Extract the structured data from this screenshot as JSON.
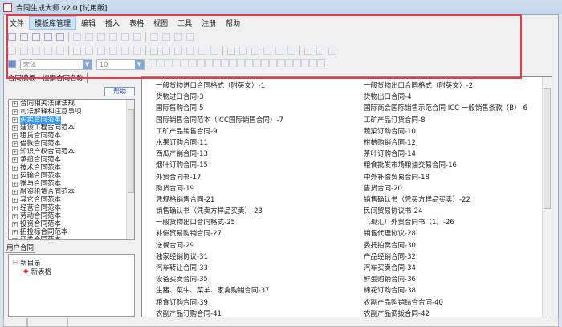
{
  "title": "合同生成大师 v2.0 [试用版]",
  "menu": [
    "文件",
    "模板库管理",
    "编辑",
    "插入",
    "表格",
    "视图",
    "工具",
    "注册",
    "帮助"
  ],
  "font": {
    "name": "宋体",
    "size": "10"
  },
  "tabs": [
    "合同模板",
    "搜索合同名称"
  ],
  "help_label": "帮助",
  "tree": [
    "合同相关法律法规",
    "司法解释和注意事项",
    "买卖合同范本",
    "建设工程合同范本",
    "租赁合同范本",
    "借款合同范本",
    "知识产权合同范本",
    "承揽合同范本",
    "技术合同范本",
    "运输合同范本",
    "赠与合同范本",
    "融资租赁合同范本",
    "其它合同范本",
    "经营合同范本",
    "劳动合同范本",
    "投资合同范本",
    "招投标合同范本",
    "证券合同范本"
  ],
  "tree_selected": 2,
  "user": {
    "header": "用户合同",
    "folder": "新目录",
    "file": "新表格"
  },
  "list_left": [
    "一般货物进口合同格式（附英文）-1",
    "货物进口合同-3",
    "国际售购合同-5",
    "国际销售合同范本（ICC国际销售合同）-7",
    "工矿产品销售合同-9",
    "水果订购合同-11",
    "西瓜产销合同-13",
    "烟叶订购合同-15",
    "外贸合同书-17",
    "购货合同-19",
    "凭规格销售合同-21",
    "销售确认书（凭卖方样品买卖）-23",
    "一般货物出口合同格式-25",
    "补偿贸易购销合同-27",
    "送餐合同-29",
    "独家经销协议-31",
    "汽车转让合同-33",
    "设备买卖合同-35",
    "生猪、菜牛、菜羊、家禽购销合同-37",
    "粮食订购合同-39",
    "农副产品订购合同-41"
  ],
  "list_right": [
    "一般货物出口合同格式（附英文）-2",
    "货物出口合同-4",
    "国际商会国际销售示范合同 ICC 一般销售条款（B）-6",
    "工矿产品订货合同-8",
    "蔬菜订购合同-10",
    "柑桔购销合同-12",
    "茶叶订购合同-14",
    "粮食批发市场粮油交易合同-16",
    "中外补偿贸易合同-18",
    "售货合同-20",
    "销售确认书（凭买方样品买卖）-22",
    "民间贸易协议书-24",
    "（现汇）外贸合同书（1）-26",
    "销售代理协议-28",
    "委托拍卖合同-30",
    "产品经销合同-32",
    "汽车买卖合同-34",
    "鲜蛋购销合同-36",
    "棉花订购合同-38",
    "农副产品购销结合合同-40",
    "农副产品调拨合同-42"
  ]
}
